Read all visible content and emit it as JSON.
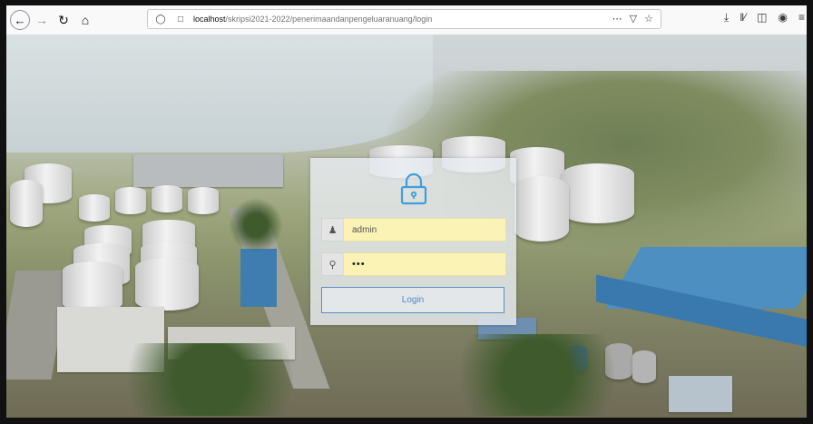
{
  "browser": {
    "url_host": "localhost",
    "url_path": "/skripsi2021-2022/penerimaandanpengeluaranuang/login",
    "icons": {
      "back": "back-arrow-icon",
      "forward": "forward-arrow-icon",
      "reload": "reload-icon",
      "home": "home-icon",
      "page_actions": "more-icon",
      "pocket": "pocket-icon",
      "bookmark": "star-icon",
      "downloads": "download-icon",
      "library": "library-icon",
      "sidebar": "sidebar-icon",
      "account": "account-icon",
      "menu": "hamburger-menu-icon"
    }
  },
  "login": {
    "username_value": "admin",
    "password_value": "•••",
    "button_label": "Login",
    "accent_color": "#4f8ac6",
    "field_fill_color": "#fbf3b5"
  }
}
